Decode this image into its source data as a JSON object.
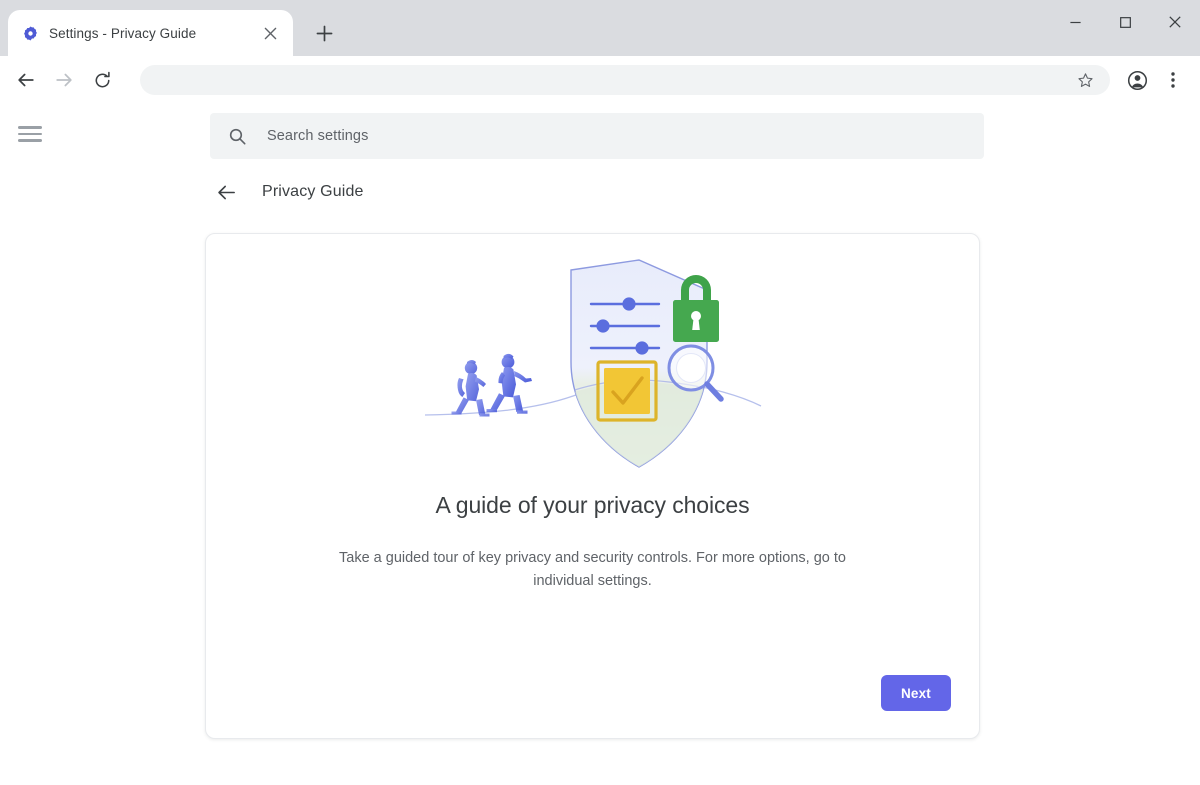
{
  "browser": {
    "tab": {
      "title": "Settings - Privacy Guide",
      "favicon": "settings-gear-icon",
      "close_icon": "close-icon"
    },
    "new_tab_icon": "plus-icon",
    "window_controls": {
      "minimize": "minimize-icon",
      "maximize": "maximize-icon",
      "close": "close-icon"
    },
    "toolbar": {
      "back_icon": "back-arrow-icon",
      "forward_icon": "forward-arrow-icon",
      "reload_icon": "reload-icon",
      "address_value": "",
      "address_placeholder": "",
      "bookmark_icon": "star-icon",
      "profile_icon": "account-avatar-icon",
      "menu_icon": "three-dot-menu-icon"
    }
  },
  "page": {
    "menu_icon": "hamburger-menu-icon",
    "search": {
      "icon": "search-icon",
      "placeholder": "Search settings",
      "value": ""
    },
    "header": {
      "back_icon": "back-arrow-icon",
      "title": "Privacy Guide"
    },
    "card": {
      "illustration": {
        "name": "privacy-guide-illustration",
        "elements": [
          "shield",
          "settings-sliders",
          "green-padlock",
          "magnifying-glass",
          "yellow-checkbox-checkmark",
          "two-walking-people",
          "path-curve"
        ]
      },
      "headline": "A guide of your privacy choices",
      "body": "Take a guided tour of key privacy and security controls. For more options, go to individual settings.",
      "next_label": "Next"
    }
  },
  "colors": {
    "accent_button": "#6366e8",
    "chrome_titlebar": "#dadce0",
    "search_field": "#f1f3f4",
    "text_primary": "#3c4043",
    "text_secondary": "#5f6368",
    "lock_green": "#3fa34a",
    "check_yellow": "#f2c635",
    "shield_blue": "#7d8bdb",
    "person_blue": "#5a6ee0",
    "favicon_blue": "#4f5bd5"
  }
}
